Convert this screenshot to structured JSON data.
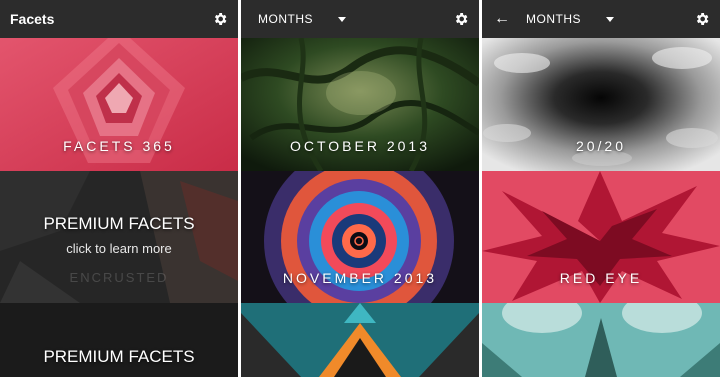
{
  "colors": {
    "appbar": "#2c2c2c",
    "accent_red": "#d7364f"
  },
  "panel1": {
    "title": "Facets",
    "tiles": [
      {
        "label": "FACETS 365"
      },
      {
        "title": "PREMIUM FACETS",
        "subtitle": "click to learn more",
        "faded": "ENCRUSTED"
      },
      {
        "title": "PREMIUM FACETS"
      }
    ]
  },
  "panel2": {
    "selector": "MONTHS",
    "tiles": [
      {
        "label": "OCTOBER 2013"
      },
      {
        "label": "NOVEMBER 2013"
      }
    ]
  },
  "panel3": {
    "selector": "MONTHS",
    "tiles": [
      {
        "label": "20/20"
      },
      {
        "label": "RED EYE"
      }
    ]
  }
}
